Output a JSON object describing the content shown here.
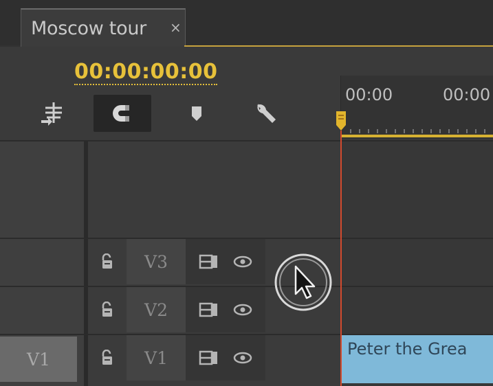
{
  "sequence_tab": {
    "label": "Moscow tour",
    "close_glyph": "×"
  },
  "timecode": "00:00:00:00",
  "toolbar": {
    "tools": [
      {
        "name": "insert-nested-sequence-icon"
      },
      {
        "name": "snap-magnet-icon",
        "active": true
      },
      {
        "name": "add-marker-icon"
      },
      {
        "name": "timeline-settings-wrench-icon"
      }
    ]
  },
  "ruler": {
    "labels": [
      "00:00",
      "00:00"
    ]
  },
  "tracks": [
    {
      "name": "V3",
      "source_patch": ""
    },
    {
      "name": "V2",
      "source_patch": ""
    },
    {
      "name": "V1",
      "source_patch": "V1"
    }
  ],
  "clip": {
    "label": "Peter the Grea"
  },
  "colors": {
    "timecode": "#e7c13a",
    "playhead": "#d34a2e",
    "clip": "#7fb9d9",
    "work_area": "#d7b232"
  }
}
